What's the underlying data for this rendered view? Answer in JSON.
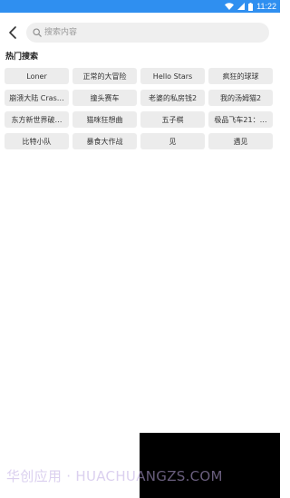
{
  "status_bar": {
    "time": "11:22",
    "icons": [
      "wifi-icon",
      "signal-icon",
      "battery-icon"
    ],
    "background": "#2f8ff0"
  },
  "search": {
    "placeholder": "搜索内容",
    "value": ""
  },
  "hot": {
    "title": "热门搜索",
    "tags": [
      "Loner",
      "正常的大冒险",
      "Hello Stars",
      "疯狂的球球",
      "崩溃大陆 Cras…",
      "撞头赛车",
      "老婆的私房钱2",
      "我的汤姆猫2",
      "东方新世界破…",
      "猫咪狂想曲",
      "五子棋",
      "极品飞车21：…",
      "比特小队",
      "暴食大作战",
      "见",
      "遇见"
    ]
  },
  "watermark": {
    "text": "华创应用 · HUACHUANGZS.COM"
  }
}
